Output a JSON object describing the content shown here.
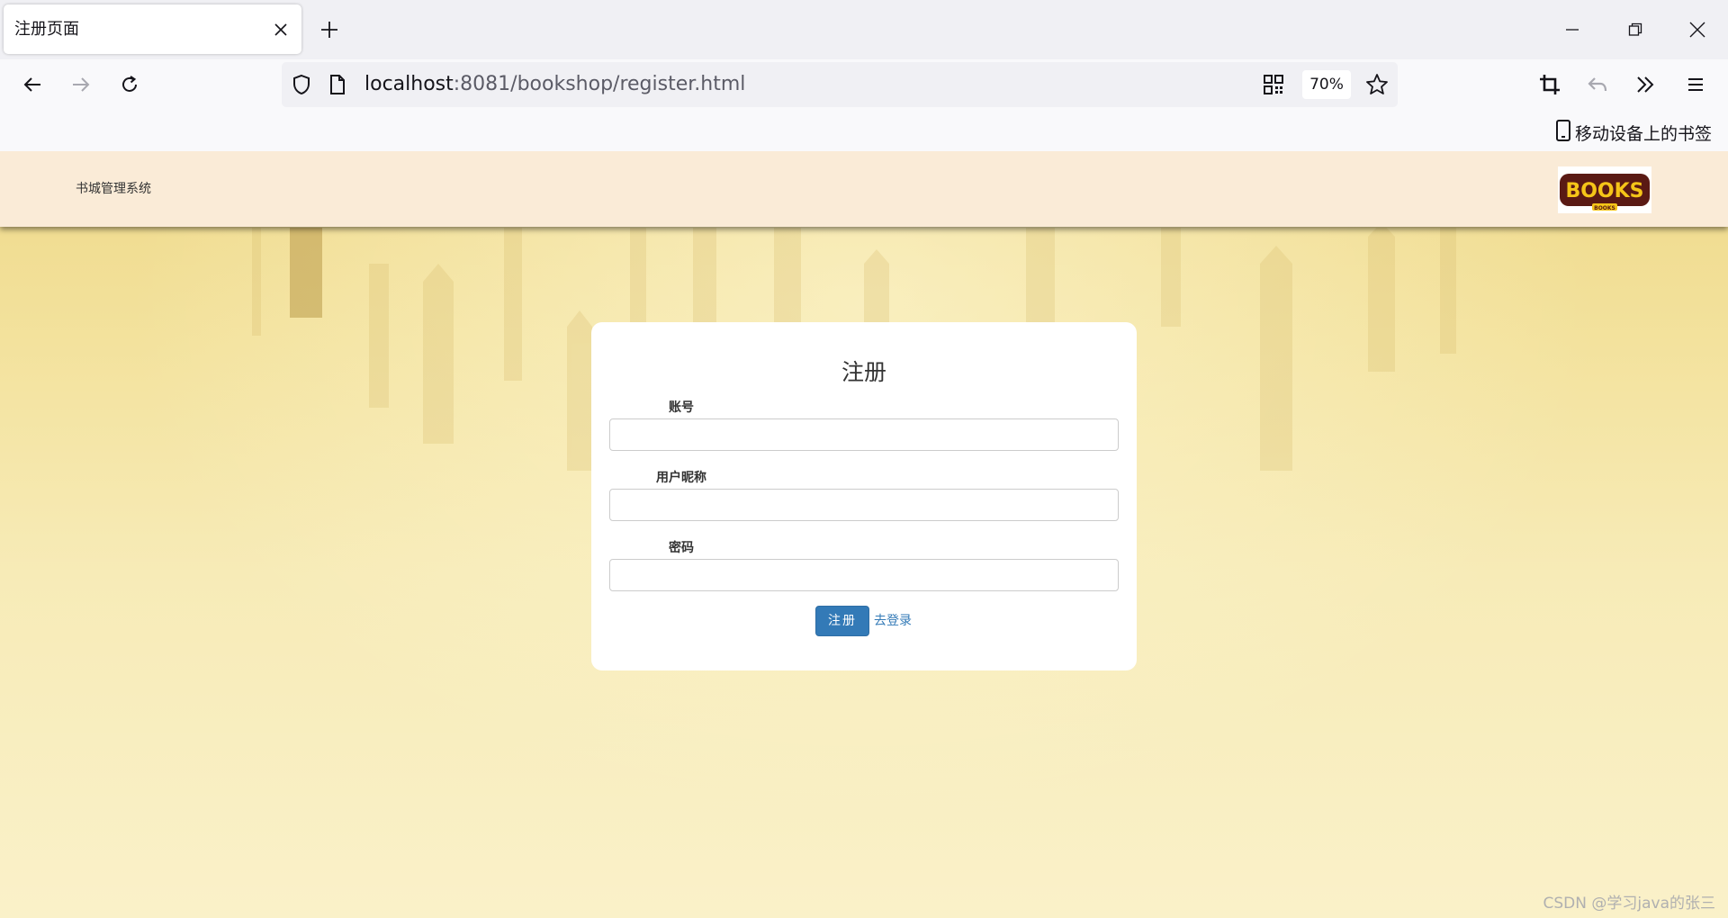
{
  "browser": {
    "tab_title": "注册页面",
    "url_host": "localhost",
    "url_rest": ":8081/bookshop/register.html",
    "zoom": "70%",
    "mobile_bookmarks_label": "移动设备上的书签"
  },
  "site": {
    "brand": "书城管理系统",
    "logo_text": "BOOKS",
    "logo_subtext": "BOOKS"
  },
  "form": {
    "title": "注册",
    "fields": [
      {
        "label": "账号",
        "value": "",
        "placeholder": ""
      },
      {
        "label": "用户昵称",
        "value": "",
        "placeholder": ""
      },
      {
        "label": "密码",
        "value": "",
        "placeholder": ""
      }
    ],
    "submit_label": "注册",
    "login_link": "去登录"
  },
  "watermark": "CSDN @学习java的张三",
  "colors": {
    "header_bg": "#faebd7",
    "primary_button": "#337ab7",
    "link": "#337ab7",
    "page_bg": "#f3e29d"
  },
  "icons": [
    "close-icon",
    "plus-icon",
    "minimize-icon",
    "restore-icon",
    "window-close-icon",
    "back-arrow-icon",
    "forward-arrow-icon",
    "reload-icon",
    "shield-icon",
    "page-icon",
    "qr-code-icon",
    "star-icon",
    "crop-icon",
    "undo-icon",
    "overflow-chevrons-icon",
    "menu-icon",
    "mobile-device-icon"
  ]
}
